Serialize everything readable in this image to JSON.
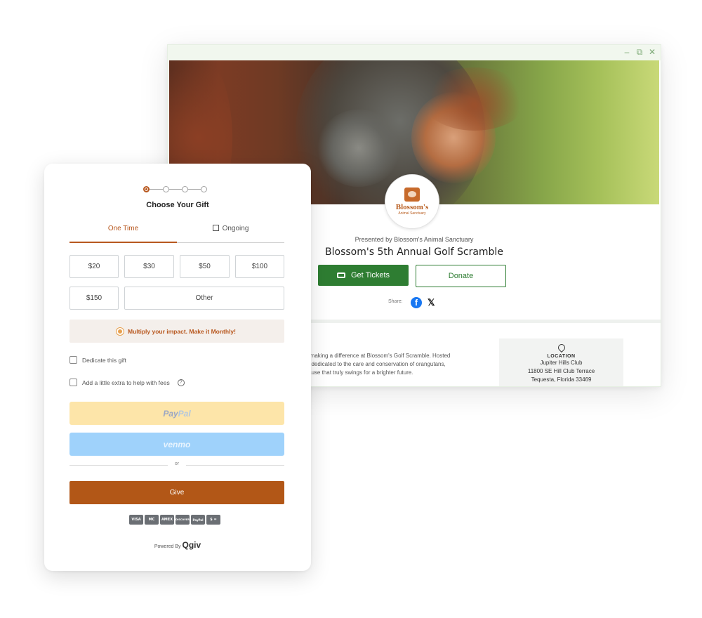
{
  "event_page": {
    "org_logo": {
      "name": "Blossom's",
      "subtitle": "Animal Sanctuary"
    },
    "presented_by": "Presented by Blossom's Animal Sanctuary",
    "title": "Blossom's 5th Annual Golf Scramble",
    "get_tickets_label": "Get Tickets",
    "donate_label": "Donate",
    "share_label": "Share:",
    "about_lines": [
      "d making a difference at Blossom's Golf Scramble. Hosted",
      "fit dedicated to the care and conservation of orangutans,",
      "cause that truly swings for a brighter future."
    ],
    "location": {
      "label": "LOCATION",
      "venue": "Jupiter Hills Club",
      "address": "11800 SE Hill Club Terrace",
      "city": "Tequesta, Florida 33469"
    },
    "window_controls": {
      "minimize": "–",
      "restore": "⧉",
      "close": "✕"
    }
  },
  "donation_form": {
    "title": "Choose Your Gift",
    "tabs": [
      {
        "label": "One Time"
      },
      {
        "label": "Ongoing"
      }
    ],
    "amounts": [
      "$20",
      "$30",
      "$50",
      "$100",
      "$150",
      "Other"
    ],
    "monthly_banner": "Multiply your impact. Make it Monthly!",
    "dedicate_label": "Dedicate this gift",
    "fees_label": "Add a little extra to help with fees",
    "paypal": {
      "part1": "Pay",
      "part2": "Pal"
    },
    "venmo_label": "venmo",
    "or_label": "or",
    "give_label": "Give",
    "payment_cards": [
      "VISA",
      "MC",
      "AMEX",
      "DISCOVER",
      "PayPal",
      "$ ="
    ],
    "powered_by": "Powered By",
    "powered_brand": "Qgiv"
  },
  "colors": {
    "accent": "#b8581f",
    "give_button": "#b25717",
    "tickets_green": "#2e7d32",
    "paypal_bg": "#fde5a9",
    "venmo_bg": "#9fd2fb",
    "facebook": "#1877f2"
  },
  "icons": [
    "minimize-icon",
    "restore-icon",
    "close-icon",
    "ticket-icon",
    "facebook-icon",
    "x-icon",
    "location-pin-icon",
    "calendar-icon",
    "sun-icon",
    "help-icon"
  ]
}
